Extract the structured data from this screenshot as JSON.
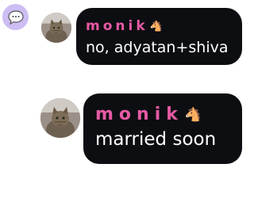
{
  "app": {
    "icon": "chat-bubble-icon"
  },
  "messages": [
    {
      "author": "monik",
      "author_emoji": "🐴",
      "text": "no, adyatan+shiva",
      "avatar": "cat-avatar"
    },
    {
      "author": "monik",
      "author_emoji": "🐴",
      "text": "married soon",
      "avatar": "cat-avatar"
    }
  ],
  "colors": {
    "bubble_background": "#0d0e12",
    "author_name": "#e65aa5",
    "message_text": "#ffffff",
    "badge_background": "#cdbdf3"
  }
}
